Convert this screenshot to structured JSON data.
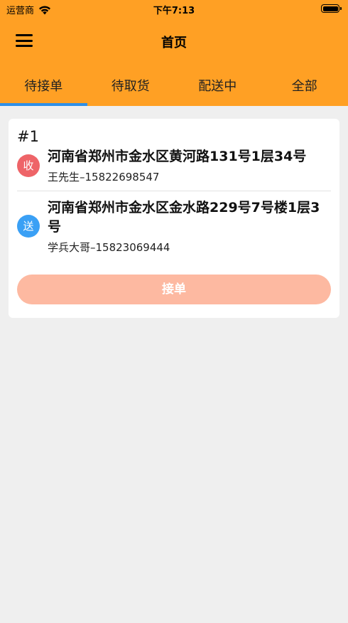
{
  "status_bar": {
    "carrier": "运营商",
    "time": "下午7:13"
  },
  "nav": {
    "title": "首页",
    "menu_icon": "hamburger-menu-icon"
  },
  "tabs": [
    {
      "label": "待接单",
      "active": true
    },
    {
      "label": "待取货",
      "active": false
    },
    {
      "label": "配送中",
      "active": false
    },
    {
      "label": "全部",
      "active": false
    }
  ],
  "order": {
    "number": "#1",
    "pickup": {
      "badge": "收",
      "address": "河南省郑州市金水区黄河路131号1层34号",
      "contact": "王先生–15822698547"
    },
    "delivery": {
      "badge": "送",
      "address": "河南省郑州市金水区金水路229号7号楼1层3号",
      "contact": "学兵大哥–15823069444"
    },
    "accept_label": "接单"
  },
  "colors": {
    "header_bg": "#ffa024",
    "tab_indicator": "#2f8fe6",
    "pickup_badge": "#ee6468",
    "delivery_badge": "#3aa0f5",
    "accept_button": "#fdb9a1",
    "page_bg": "#efefef"
  }
}
